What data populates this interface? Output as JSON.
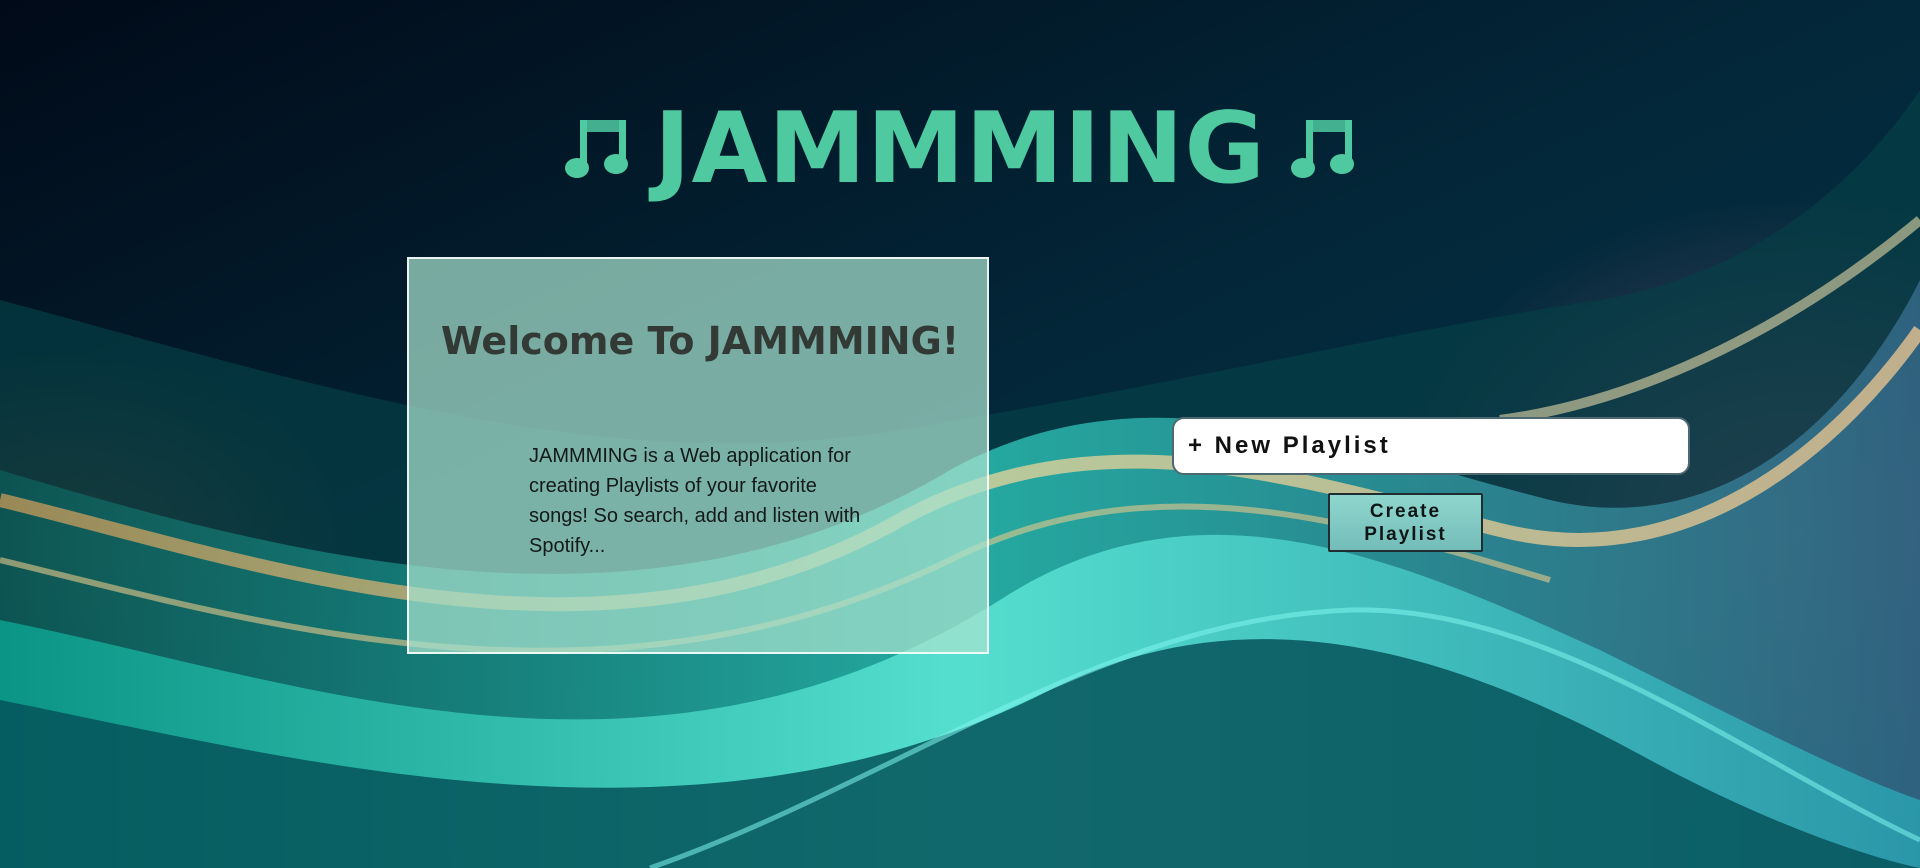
{
  "header": {
    "title": "JAMMMING",
    "left_icon": "music-note-icon",
    "right_icon": "music-note-icon"
  },
  "welcome": {
    "title": "Welcome To JAMMMING!",
    "description": "JAMMMING is a Web application for creating Playlists of your favorite songs! So search, add and listen with Spotify..."
  },
  "playlist": {
    "input_placeholder": "+ New Playlist",
    "create_button_label": "Create Playlist"
  },
  "colors": {
    "accent": "#4fcaa0",
    "background": "#021222",
    "card": "#a8e2ce"
  }
}
